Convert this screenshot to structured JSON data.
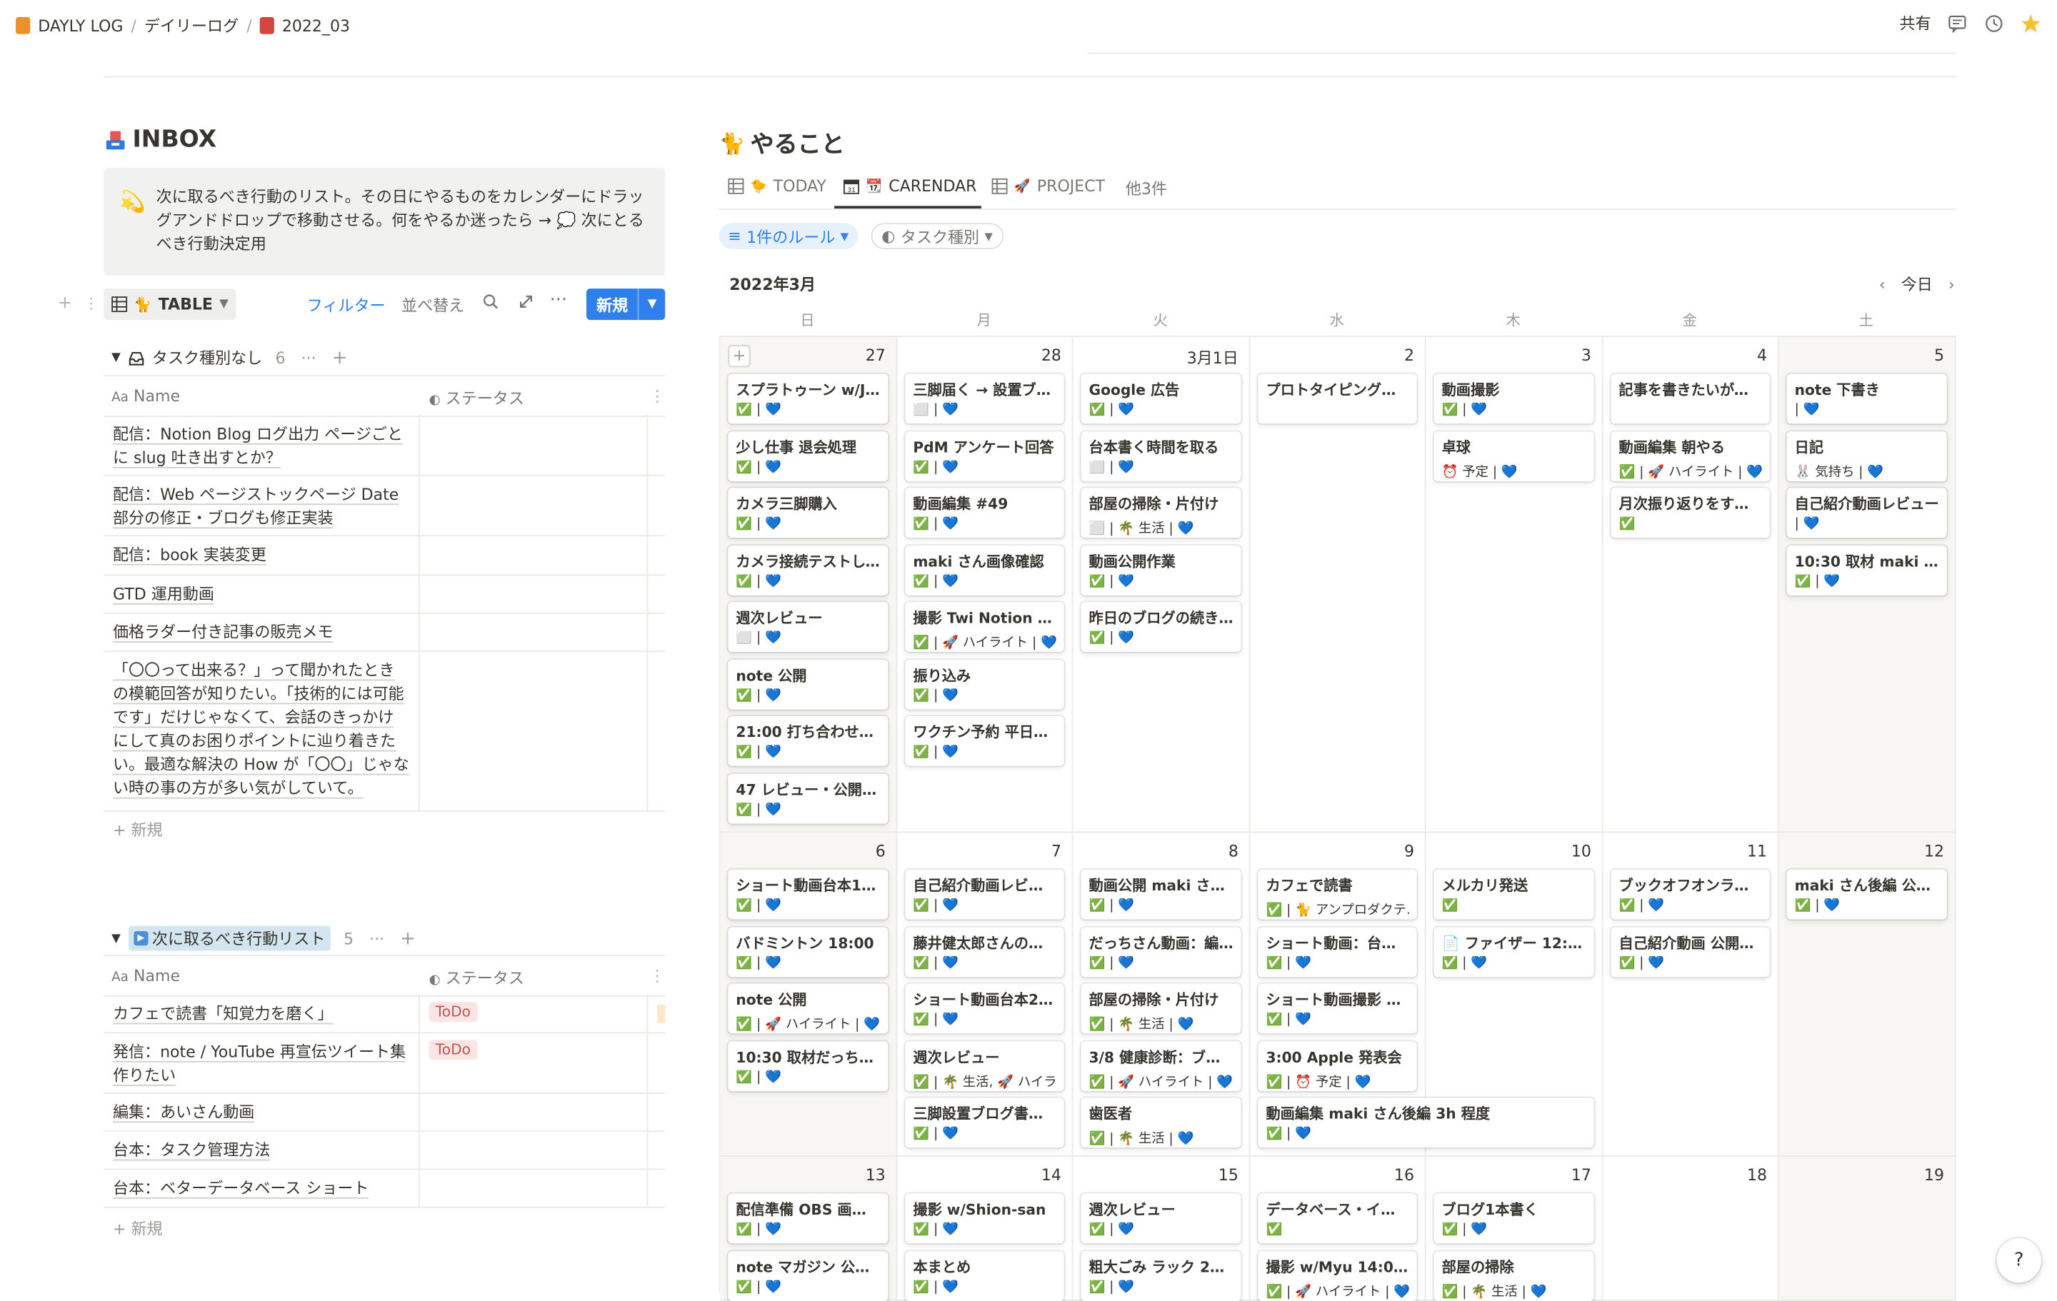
{
  "breadcrumb": [
    {
      "label": "DAYLY LOG",
      "icon": "orange-book-icon",
      "color": "#e8922e"
    },
    {
      "label": "デイリーログ"
    },
    {
      "label": "2022_03",
      "icon": "red-book-icon",
      "color": "#d4453f"
    }
  ],
  "topbar": {
    "share": "共有"
  },
  "inbox": {
    "title": "INBOX",
    "callout": "次に取るべき行動のリスト。その日にやるものをカレンダーにドラッグアンドドロップで移動させる。何をやるか迷ったら → 💭 次にとるべき行動決定用",
    "view_label": "TABLE",
    "filter": "フィルター",
    "sort": "並べ替え",
    "new": "新規",
    "col_name": "Name",
    "col_status": "ステータス",
    "add_row": "新規",
    "group1": {
      "label": "タスク種別なし",
      "count": "6",
      "rows": [
        {
          "name": "配信：Notion Blog ログ出力 ページごとに slug 吐き出すとか？"
        },
        {
          "name": "配信：Web ページストックページ Date 部分の修正・ブログも修正実装"
        },
        {
          "name": "配信：book 実装変更"
        },
        {
          "name": "GTD 運用動画"
        },
        {
          "name": "価格ラダー付き記事の販売メモ"
        },
        {
          "name": "「〇〇って出来る？」って聞かれたときの模範回答が知りたい。「技術的には可能です」だけじゃなくて、会話のきっかけにして真のお困りポイントに辿り着きたい。最適な解決の How が「〇〇」じゃない時の事の方が多い気がしていて。"
        }
      ]
    },
    "group2": {
      "label": "次に取るべき行動リスト",
      "count": "5",
      "rows": [
        {
          "name": "カフェで読書「知覚力を磨く」",
          "status": "ToDo"
        },
        {
          "name": "発信：note / YouTube 再宣伝ツイート集作りたい",
          "status": "ToDo"
        },
        {
          "name": "編集：あいさん動画",
          "status": ""
        },
        {
          "name": "台本：タスク管理方法",
          "status": ""
        },
        {
          "name": "台本：ベターデータベース ショート",
          "status": ""
        }
      ]
    }
  },
  "todo": {
    "title": "やること",
    "tabs": [
      {
        "label": "TODAY",
        "icon": "table-icon"
      },
      {
        "label": "CARENDAR",
        "icon": "calendar-icon"
      },
      {
        "label": "PROJECT",
        "icon": "table-icon"
      },
      {
        "label": "他3件"
      }
    ],
    "rule_filter": "1件のルール",
    "type_filter": "タスク種別",
    "month": "2022年3月",
    "today": "今日",
    "weekdays": [
      "日",
      "月",
      "火",
      "水",
      "木",
      "金",
      "土"
    ],
    "weeks": [
      {
        "days": [
          {
            "num": "27",
            "cards": [
              {
                "title": "スプラトゥーン w/JA...",
                "props": "✅ | 💙"
              },
              {
                "title": "少し仕事 退会処理",
                "props": "✅ | 💙"
              },
              {
                "title": "カメラ三脚購入",
                "props": "✅ | 💙"
              },
              {
                "title": "カメラ接続テストして...",
                "props": "✅ | 💙"
              },
              {
                "title": "週次レビュー",
                "props": "⬜ | 💙"
              },
              {
                "title": "note 公開",
                "props": "✅ | 💙"
              },
              {
                "title": "21:00 打ち合わせま...",
                "props": "✅ | 💙"
              },
              {
                "title": "47 レビュー・公開作業",
                "props": "✅ | 💙"
              }
            ]
          },
          {
            "num": "28",
            "cards": [
              {
                "title": "三脚届く → 設置ブロ...",
                "props": "⬜ | 💙"
              },
              {
                "title": "PdM アンケート回答",
                "props": "✅ | 💙"
              },
              {
                "title": "動画編集 #49",
                "props": "✅ | 💙"
              },
              {
                "title": "maki さん画像確認",
                "props": "✅ | 💙"
              },
              {
                "title": "撮影 Twi Notion のやつ",
                "props": "✅ | 🚀 ハイライト | 💙"
              },
              {
                "title": "振り込み",
                "props": "✅ | 💙"
              },
              {
                "title": "ワクチン予約 平日（...",
                "props": "✅ | 💙"
              }
            ]
          },
          {
            "num": "3月1日",
            "cards": [
              {
                "title": "Google 広告",
                "props": "✅ | 💙"
              },
              {
                "title": "台本書く時間を取る",
                "props": "⬜ | 💙"
              },
              {
                "title": "部屋の掃除・片付け",
                "props": "⬜ | 🌴 生活 | 💙"
              },
              {
                "title": "動画公開作業",
                "props": "✅ | 💙"
              },
              {
                "title": "昨日のブログの続き...",
                "props": "✅ | 💙"
              }
            ]
          },
          {
            "num": "2",
            "cards": [
              {
                "title": "プロトタイピングする",
                "props": ""
              }
            ]
          },
          {
            "num": "3",
            "cards": [
              {
                "title": "動画撮影",
                "props": "✅ | 💙"
              },
              {
                "title": "卓球",
                "props": "⏰ 予定 | 💙"
              }
            ]
          },
          {
            "num": "4",
            "cards": [
              {
                "title": "記事を書きたいが、...",
                "props": ""
              },
              {
                "title": "動画編集 朝やる",
                "props": "✅ | 🚀 ハイライト | 💙"
              },
              {
                "title": "月次振り返りをする 2...",
                "props": "✅"
              }
            ]
          },
          {
            "num": "5",
            "cards": [
              {
                "title": "note 下書き",
                "props": "| 💙"
              },
              {
                "title": "日記",
                "props": "🐰 気持ち | 💙",
                "icon": "🐰"
              },
              {
                "title": "自己紹介動画レビュー",
                "props": "| 💙"
              },
              {
                "title": "10:30 取材 maki さん",
                "props": "✅ | 💙"
              }
            ]
          }
        ]
      },
      {
        "days": [
          {
            "num": "6",
            "cards": [
              {
                "title": "ショート動画台本1 0....",
                "props": "✅ | 💙"
              },
              {
                "title": "バドミントン 18:00",
                "props": "✅ | 💙"
              },
              {
                "title": "note 公開",
                "props": "✅ | 🚀 ハイライト | 💙"
              },
              {
                "title": "10:30 取材だっちさん",
                "props": "✅ | 💙"
              }
            ]
          },
          {
            "num": "7",
            "cards": [
              {
                "title": "自己紹介動画レビュ...",
                "props": "✅ | 💙"
              },
              {
                "title": "藤井健太郎さんの本...",
                "props": "✅ | 💙"
              },
              {
                "title": "ショート動画台本2~4...",
                "props": "✅ | 💙"
              },
              {
                "title": "週次レビュー",
                "props": "✅ | 🌴 生活, 🚀 ハイラ..."
              },
              {
                "title": "三脚設置ブログ書き...",
                "props": "✅ | 💙"
              }
            ]
          },
          {
            "num": "8",
            "cards": [
              {
                "title": "動画公開 maki さん前...",
                "props": "✅ | 💙"
              },
              {
                "title": "だっちさん動画：編...",
                "props": "✅ | 💙"
              },
              {
                "title": "部屋の掃除・片付け",
                "props": "✅ | 🌴 生活 | 💙"
              },
              {
                "title": "3/8 健康診断：ブログ...",
                "props": "✅ | 🚀 ハイライト | 💙"
              },
              {
                "title": "歯医者",
                "props": "✅ | 🌴 生活 | 💙"
              }
            ]
          },
          {
            "num": "9",
            "cards": [
              {
                "title": "カフェで読書",
                "props": "✅ | 🐈 アンプロダクテ..."
              },
              {
                "title": "ショート動画：台本...",
                "props": "✅ | 💙"
              },
              {
                "title": "ショート動画撮影 2h ...",
                "props": "✅ | 💙"
              },
              {
                "title": "3:00 Apple 発表会",
                "props": "✅ | ⏰ 予定 | 💙"
              },
              {
                "title": "動画編集 maki さん後編 3h 程度",
                "props": "✅ | 💙",
                "span": 2
              }
            ]
          },
          {
            "num": "10",
            "cards": [
              {
                "title": "メルカリ発送",
                "props": "✅"
              },
              {
                "title": "📄 ファイザー 12:00",
                "props": "✅ | 💙"
              }
            ]
          },
          {
            "num": "11",
            "cards": [
              {
                "title": "ブックオフオンライ...",
                "props": "✅ | 💙"
              },
              {
                "title": "自己紹介動画 公開作...",
                "props": "✅ | 💙"
              }
            ]
          },
          {
            "num": "12",
            "cards": [
              {
                "title": "maki さん後編 公開作...",
                "props": "✅ | 💙"
              }
            ]
          }
        ]
      },
      {
        "days": [
          {
            "num": "13",
            "cards": [
              {
                "title": "配信準備 OBS 画面づ...",
                "props": "✅ | 💙"
              },
              {
                "title": "note マガジン 公開ま...",
                "props": "✅ | 💙"
              }
            ]
          },
          {
            "num": "14",
            "cards": [
              {
                "title": "撮影 w/Shion-san",
                "props": "✅ | 💙"
              },
              {
                "title": "本まとめ",
                "props": "✅ | 💙"
              }
            ]
          },
          {
            "num": "15",
            "cards": [
              {
                "title": "週次レビュー",
                "props": "✅ | 💙"
              },
              {
                "title": "粗大ごみ ラック 200円",
                "props": "✅ | 💙"
              }
            ]
          },
          {
            "num": "16",
            "cards": [
              {
                "title": "データベース・インプ...",
                "props": "✅"
              },
              {
                "title": "撮影 w/Myu 14:00 @...",
                "props": "✅ | 🚀 ハイライト | 💙"
              }
            ]
          },
          {
            "num": "17",
            "cards": [
              {
                "title": "ブログ1本書く",
                "props": "✅ | 💙"
              },
              {
                "title": "部屋の掃除",
                "props": "✅ | 🌴 生活 | 💙"
              }
            ]
          },
          {
            "num": "18",
            "cards": []
          },
          {
            "num": "19",
            "cards": []
          }
        ]
      }
    ]
  },
  "help": "?"
}
